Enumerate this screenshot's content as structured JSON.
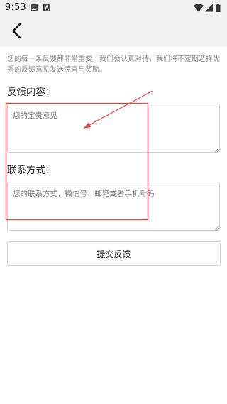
{
  "status_bar": {
    "time": "9:53",
    "left_icons": [
      "image-icon",
      "a-box-icon"
    ],
    "right_icons": [
      "wifi-icon",
      "cellular-signal-icon",
      "battery-icon"
    ]
  },
  "app_bar": {
    "back_icon": "chevron-left-icon"
  },
  "notice": {
    "text": "您的每一条反馈都非常重要，我们会认真对待，我们将不定期选择优秀的反馈意见发送惊喜与奖励。"
  },
  "feedback": {
    "label": "反馈内容：",
    "placeholder": "您的宝贵意见"
  },
  "contact": {
    "label": "联系方式：",
    "placeholder": "您的联系方式，微信号、邮箱或者手机号码"
  },
  "submit": {
    "label": "提交反馈"
  },
  "annotation": {
    "color": "#e0474c",
    "box_shape": "rectangle",
    "arrow_icon": "red-arrow"
  }
}
